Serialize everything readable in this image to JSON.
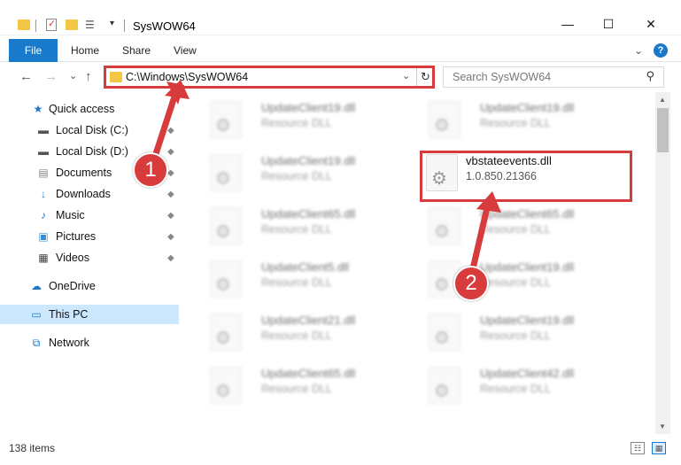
{
  "window": {
    "title": "SysWOW64",
    "minimize": "—",
    "maximize": "☐",
    "close": "✕"
  },
  "ribbon": {
    "file": "File",
    "home": "Home",
    "share": "Share",
    "view": "View",
    "collapse": "⌄",
    "help": "?"
  },
  "nav": {
    "back": "←",
    "forward": "→",
    "recent": "⌄",
    "up": "↑",
    "path": "C:\\Windows\\SysWOW64",
    "dropdown": "⌄",
    "refresh": "↻",
    "search_placeholder": "Search SysWOW64",
    "search_icon": "⚲"
  },
  "sidebar": {
    "items": [
      {
        "label": "Quick access",
        "icon": "star-icon",
        "glyph": "★"
      },
      {
        "label": "Local Disk (C:)",
        "icon": "drive-icon",
        "glyph": "▬"
      },
      {
        "label": "Local Disk (D:)",
        "icon": "drive-icon",
        "glyph": "▬"
      },
      {
        "label": "Documents",
        "icon": "documents-icon",
        "glyph": "▤"
      },
      {
        "label": "Downloads",
        "icon": "download-icon",
        "glyph": "↓"
      },
      {
        "label": "Music",
        "icon": "music-icon",
        "glyph": "♪"
      },
      {
        "label": "Pictures",
        "icon": "pictures-icon",
        "glyph": "▣"
      },
      {
        "label": "Videos",
        "icon": "videos-icon",
        "glyph": "▦"
      },
      {
        "label": "OneDrive",
        "icon": "cloud-icon",
        "glyph": "☁"
      },
      {
        "label": "This PC",
        "icon": "computer-icon",
        "glyph": "▭"
      },
      {
        "label": "Network",
        "icon": "network-icon",
        "glyph": "⧉"
      }
    ],
    "pin": "📌"
  },
  "files": [
    {
      "name": "UpdateClient19.dll",
      "desc": "Resource DLL"
    },
    {
      "name": "UpdateClient19.dll",
      "desc": "Resource DLL"
    },
    {
      "name": "UpdateClient19.dll",
      "desc": "Resource DLL"
    },
    {
      "name": "vbstateevents.dll",
      "desc": "1.0.850.21366"
    },
    {
      "name": "UpdateClient65.dll",
      "desc": "Resource DLL"
    },
    {
      "name": "UpdateClient65.dll",
      "desc": "Resource DLL"
    },
    {
      "name": "UpdateClient5.dll",
      "desc": "Resource DLL"
    },
    {
      "name": "UpdateClient19.dll",
      "desc": "Resource DLL"
    },
    {
      "name": "UpdateClient21.dll",
      "desc": "Resource DLL"
    },
    {
      "name": "UpdateClient19.dll",
      "desc": "Resource DLL"
    },
    {
      "name": "UpdateClient65.dll",
      "desc": "Resource DLL"
    },
    {
      "name": "UpdateClient42.dll",
      "desc": "Resource DLL"
    }
  ],
  "status": {
    "count": "138 items"
  },
  "annotations": {
    "step1": "1",
    "step2": "2",
    "color": "#d83b3b"
  },
  "colors": {
    "accent": "#1979ca",
    "selected": "#cce8ff",
    "folder": "#f3c744"
  }
}
